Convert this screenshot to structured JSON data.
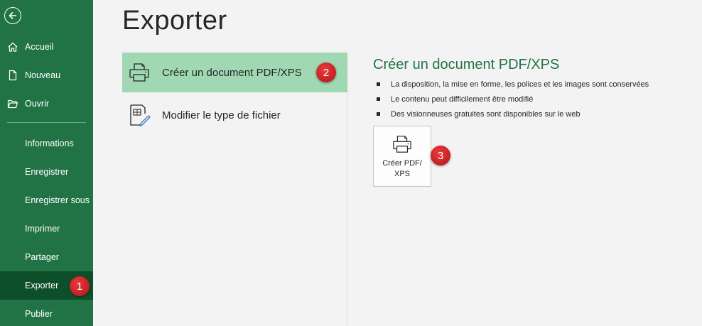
{
  "sidebar": {
    "items": [
      {
        "label": "Accueil",
        "icon": "home-icon"
      },
      {
        "label": "Nouveau",
        "icon": "new-document-icon"
      },
      {
        "label": "Ouvrir",
        "icon": "open-folder-icon"
      },
      {
        "label": "Informations"
      },
      {
        "label": "Enregistrer"
      },
      {
        "label": "Enregistrer sous"
      },
      {
        "label": "Imprimer"
      },
      {
        "label": "Partager"
      },
      {
        "label": "Exporter",
        "active": true
      },
      {
        "label": "Publier"
      }
    ]
  },
  "page": {
    "title": "Exporter"
  },
  "options": [
    {
      "label": "Créer un document PDF/XPS",
      "icon": "printer-icon",
      "selected": true
    },
    {
      "label": "Modifier le type de fichier",
      "icon": "change-file-type-icon"
    }
  ],
  "detail": {
    "title": "Créer un document PDF/XPS",
    "bullets": [
      "La disposition, la mise en forme, les polices et les images sont conservées",
      "Le contenu peut difficilement être modifié",
      "Des visionneuses gratuites sont disponibles sur le web"
    ],
    "button_label": "Créer PDF/ XPS"
  },
  "badges": {
    "one": "1",
    "two": "2",
    "three": "3"
  },
  "colors": {
    "accent": "#217346",
    "active_nav": "#0e4f2b",
    "selected_option": "#a0d8b3",
    "badge": "#d7262b"
  }
}
